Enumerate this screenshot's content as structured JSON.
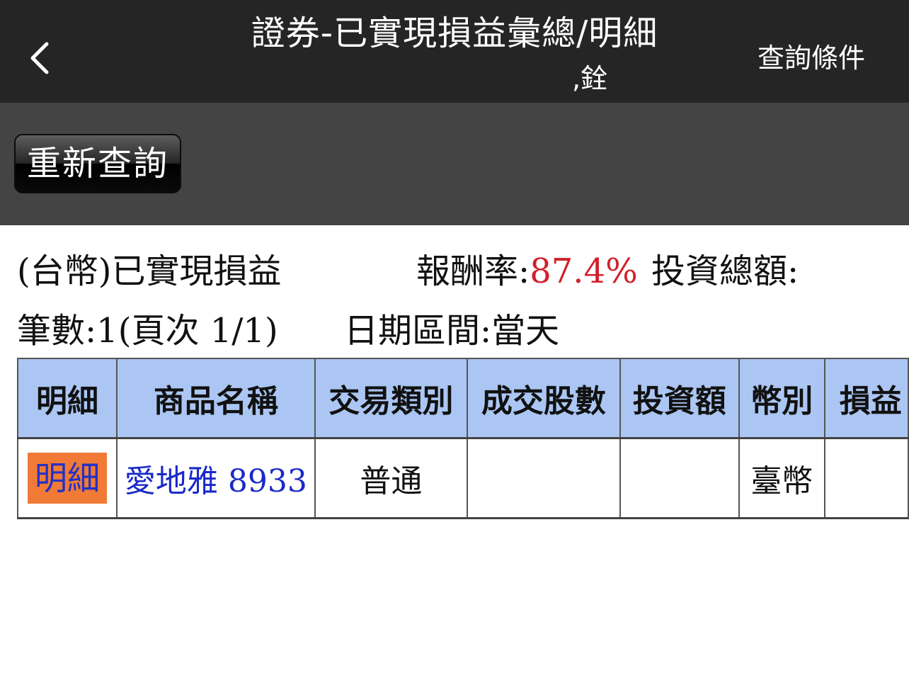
{
  "header": {
    "title": "證券-已實現損益彙總/明細",
    "subtitle": ",銓",
    "query_conditions": "查詢條件",
    "back_icon": "chevron-left-icon"
  },
  "toolbar": {
    "requery_label": "重新查詢"
  },
  "summary": {
    "currency_label": "(台幣)已實現損益",
    "return_label": "報酬率:",
    "return_value": "87.4%",
    "invest_total_label": "投資總額:",
    "count_label": "筆數:1(頁次 1/1)",
    "date_range_label": "日期區間:當天"
  },
  "colors": {
    "header_bg": "#252525",
    "toolbar_bg": "#444444",
    "table_header_bg": "#abc6f3",
    "detail_button_bg": "#f07a36",
    "link_color": "#1929c9",
    "positive_color": "#d1202a"
  },
  "table": {
    "columns": [
      "明細",
      "商品名稱",
      "交易類別",
      "成交股數",
      "投資額",
      "幣別",
      "損益"
    ],
    "rows": [
      {
        "detail": "明細",
        "product": "愛地雅 8933",
        "trade_type": "普通",
        "shares": "",
        "investment": "",
        "currency": "臺幣",
        "pnl": ""
      }
    ]
  }
}
